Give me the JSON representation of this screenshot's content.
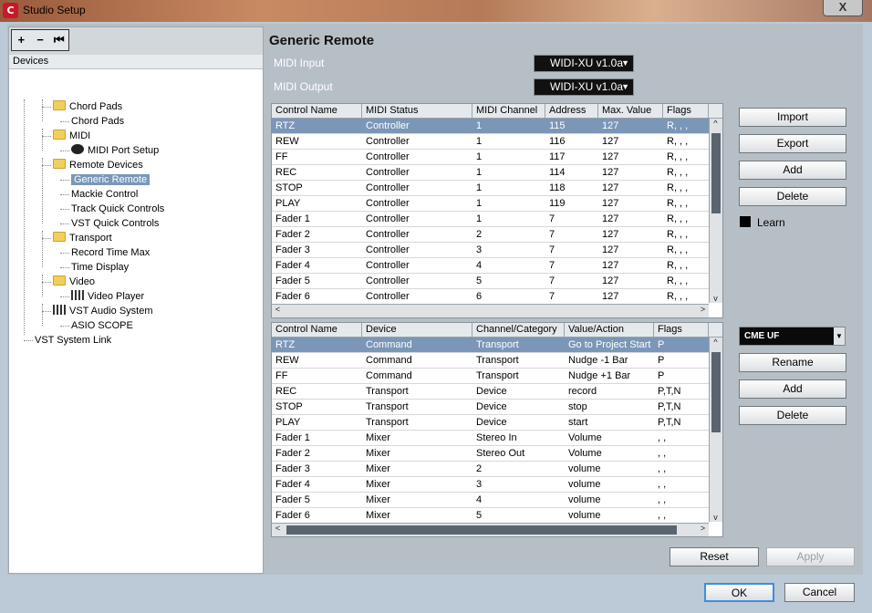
{
  "window": {
    "title": "Studio Setup",
    "close_glyph": "X"
  },
  "toolbar": {
    "add": "+",
    "remove": "−",
    "reset": "⏮"
  },
  "devices_header": "Devices",
  "tree": [
    {
      "label": "Chord Pads",
      "level": 1,
      "icon": "folder-icon"
    },
    {
      "label": "Chord Pads",
      "level": 2,
      "icon": ""
    },
    {
      "label": "MIDI",
      "level": 1,
      "icon": "folder-icon"
    },
    {
      "label": "MIDI Port Setup",
      "level": 2,
      "icon": "midi-port-icon"
    },
    {
      "label": "Remote Devices",
      "level": 1,
      "icon": "folder-icon"
    },
    {
      "label": "Generic Remote",
      "level": 2,
      "icon": "",
      "selected": true
    },
    {
      "label": "Mackie Control",
      "level": 2,
      "icon": ""
    },
    {
      "label": "Track Quick Controls",
      "level": 2,
      "icon": ""
    },
    {
      "label": "VST Quick Controls",
      "level": 2,
      "icon": ""
    },
    {
      "label": "Transport",
      "level": 1,
      "icon": "folder-icon"
    },
    {
      "label": "Record Time Max",
      "level": 2,
      "icon": ""
    },
    {
      "label": "Time Display",
      "level": 2,
      "icon": ""
    },
    {
      "label": "Video",
      "level": 1,
      "icon": "folder-icon"
    },
    {
      "label": "Video Player",
      "level": 2,
      "icon": "video-player-icon"
    },
    {
      "label": "VST Audio System",
      "level": 1,
      "icon": "audio-system-icon"
    },
    {
      "label": "ASIO SCOPE",
      "level": 2,
      "icon": ""
    },
    {
      "label": "VST System Link",
      "level": 0,
      "icon": ""
    }
  ],
  "main": {
    "title": "Generic Remote",
    "midi_input_label": "MIDI Input",
    "midi_input_value": "WIDI-XU v1.0a",
    "midi_output_label": "MIDI Output",
    "midi_output_value": "WIDI-XU v1.0a"
  },
  "table1": {
    "headers": [
      "Control Name",
      "MIDI Status",
      "MIDI Channel",
      "Address",
      "Max. Value",
      "Flags"
    ],
    "rows": [
      [
        "RTZ",
        "Controller",
        "1",
        "115",
        "127",
        "R, , ,"
      ],
      [
        "REW",
        "Controller",
        "1",
        "116",
        "127",
        "R, , ,"
      ],
      [
        "FF",
        "Controller",
        "1",
        "117",
        "127",
        "R, , ,"
      ],
      [
        "REC",
        "Controller",
        "1",
        "114",
        "127",
        "R, , ,"
      ],
      [
        "STOP",
        "Controller",
        "1",
        "118",
        "127",
        "R, , ,"
      ],
      [
        "PLAY",
        "Controller",
        "1",
        "119",
        "127",
        "R, , ,"
      ],
      [
        "Fader 1",
        "Controller",
        "1",
        "7",
        "127",
        "R, , ,"
      ],
      [
        "Fader 2",
        "Controller",
        "2",
        "7",
        "127",
        "R, , ,"
      ],
      [
        "Fader 3",
        "Controller",
        "3",
        "7",
        "127",
        "R, , ,"
      ],
      [
        "Fader 4",
        "Controller",
        "4",
        "7",
        "127",
        "R, , ,"
      ],
      [
        "Fader 5",
        "Controller",
        "5",
        "7",
        "127",
        "R, , ,"
      ],
      [
        "Fader 6",
        "Controller",
        "6",
        "7",
        "127",
        "R, , ,"
      ]
    ]
  },
  "table2": {
    "headers": [
      "Control Name",
      "Device",
      "Channel/Category",
      "Value/Action",
      "Flags"
    ],
    "rows": [
      [
        "RTZ",
        "Command",
        "Transport",
        "Go to Project Start",
        "P"
      ],
      [
        "REW",
        "Command",
        "Transport",
        "Nudge -1 Bar",
        "P"
      ],
      [
        "FF",
        "Command",
        "Transport",
        "Nudge +1 Bar",
        "P"
      ],
      [
        "REC",
        "Transport",
        "Device",
        "record",
        "P,T,N"
      ],
      [
        "STOP",
        "Transport",
        "Device",
        "stop",
        "P,T,N"
      ],
      [
        "PLAY",
        "Transport",
        "Device",
        "start",
        "P,T,N"
      ],
      [
        "Fader 1",
        "Mixer",
        "Stereo In",
        "Volume",
        ", ,"
      ],
      [
        "Fader 2",
        "Mixer",
        "Stereo Out",
        "Volume",
        ", ,"
      ],
      [
        "Fader 3",
        "Mixer",
        "2",
        "volume",
        ", ,"
      ],
      [
        "Fader 4",
        "Mixer",
        "3",
        "volume",
        ", ,"
      ],
      [
        "Fader 5",
        "Mixer",
        "4",
        "volume",
        ", ,"
      ],
      [
        "Fader 6",
        "Mixer",
        "5",
        "volume",
        ", ,"
      ]
    ]
  },
  "buttons": {
    "import": "Import",
    "export": "Export",
    "add": "Add",
    "delete": "Delete",
    "learn": "Learn",
    "preset": "CME UF",
    "rename": "Rename",
    "add2": "Add",
    "delete2": "Delete",
    "reset": "Reset",
    "apply": "Apply",
    "ok": "OK",
    "cancel": "Cancel"
  },
  "glyphs": {
    "down": "▼",
    "up": "▲",
    "left": "<",
    "right": ">",
    "vdown": "v",
    "vup": "^"
  },
  "colors": {
    "selection": "#7b97b8",
    "panel": "#b7bfc6"
  }
}
